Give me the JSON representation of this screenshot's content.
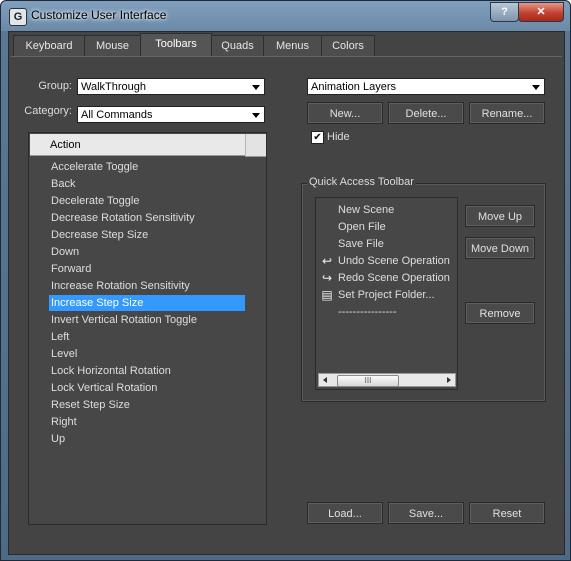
{
  "window": {
    "title": "Customize User Interface",
    "help_label": "?",
    "close_label": "✕"
  },
  "tabs": [
    {
      "label": "Keyboard"
    },
    {
      "label": "Mouse"
    },
    {
      "label": "Toolbars",
      "active": true
    },
    {
      "label": "Quads"
    },
    {
      "label": "Menus"
    },
    {
      "label": "Colors"
    }
  ],
  "filters": {
    "group_label": "Group:",
    "group_value": "WalkThrough",
    "category_label": "Category:",
    "category_value": "All Commands"
  },
  "action_list": {
    "header": "Action",
    "items": [
      "Accelerate Toggle",
      "Back",
      "Decelerate Toggle",
      "Decrease Rotation Sensitivity",
      "Decrease Step Size",
      "Down",
      "Forward",
      "Increase Rotation Sensitivity",
      "Increase Step Size",
      "Invert Vertical Rotation Toggle",
      "Left",
      "Level",
      "Lock Horizontal Rotation",
      "Lock Vertical Rotation",
      "Reset Step Size",
      "Right",
      "Up"
    ],
    "selected": "Increase Step Size"
  },
  "toolbar_select": {
    "value": "Animation Layers"
  },
  "toolbar_buttons": {
    "new": "New...",
    "delete": "Delete...",
    "rename": "Rename..."
  },
  "hide": {
    "label": "Hide",
    "checked": true,
    "mark": "✔"
  },
  "quick_access": {
    "title": "Quick Access Toolbar",
    "items": [
      {
        "label": "New Scene",
        "icon": ""
      },
      {
        "label": "Open File",
        "icon": ""
      },
      {
        "label": "Save File",
        "icon": ""
      },
      {
        "label": "Undo Scene Operation",
        "icon": "↩"
      },
      {
        "label": "Redo Scene Operation",
        "icon": "↪"
      },
      {
        "label": "Set Project Folder...",
        "icon": "▤"
      },
      {
        "label": "----------------",
        "icon": ""
      }
    ],
    "scroll_grip": "III",
    "move_up": "Move Up",
    "move_down": "Move Down",
    "remove": "Remove"
  },
  "footer": {
    "load": "Load...",
    "save": "Save...",
    "reset": "Reset"
  }
}
